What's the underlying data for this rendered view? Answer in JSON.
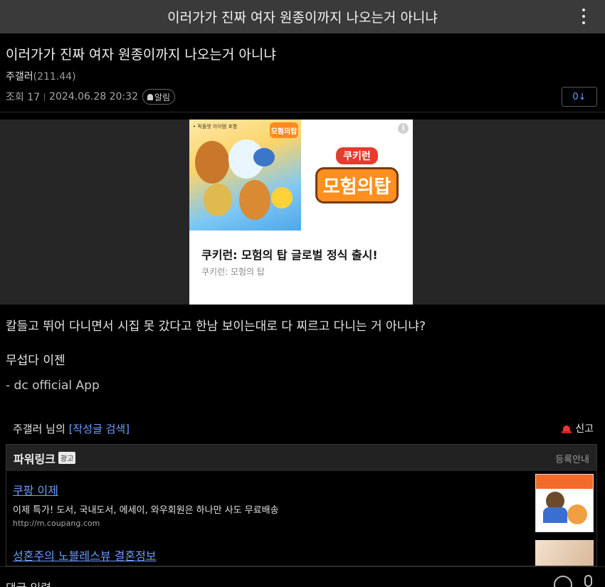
{
  "header": {
    "title": "이러가가 진짜 여자 원종이까지 나오는거 아니냐"
  },
  "post": {
    "title": "이러가가 진짜 여자 원종이까지 나오는거 아니냐",
    "author": "주갤러",
    "author_ip": "(211.44)",
    "views": "조회 17",
    "datetime": "2024.06.28 20:32",
    "alarm_label": "알림",
    "recommend_label": "0↓",
    "body": [
      "칼들고 뛰어 다니면서 시집 못 갔다고 한남 보이는대로 다 찌르고 다니는 거 아니냐?",
      "무섭다 이젠",
      "- dc official App"
    ]
  },
  "ad": {
    "tag": "• 픽플렛 아이템 포함",
    "mini_logo": "모험의탑",
    "logo_top": "쿠키런",
    "logo_main": "모험의탑",
    "info": "i",
    "headline": "쿠키런: 모험의 탑 글로벌 정식 출시!",
    "sub": "쿠키런: 모험의 탑"
  },
  "author_section": {
    "prefix": "주갤러 님의",
    "search_link": "[작성글 검색]",
    "report_label": "신고"
  },
  "powerlink": {
    "title": "파워링크",
    "ad_badge": "광고",
    "register_label": "등록안내",
    "items": [
      {
        "title": "쿠팡 이제",
        "desc": "이제 특가! 도서, 국내도서, 에세이, 와우회원은 하나만 사도 무료배송",
        "url": "http://m.coupang.com"
      },
      {
        "title": "성혼주의 노블레스뷰 결혼정보"
      }
    ]
  },
  "comment": {
    "placeholder": "댓글 입력"
  },
  "colors": {
    "link": "#6f9cff",
    "topbar": "#3a3a3a",
    "background": "#000000",
    "ad_band": "#262626"
  }
}
